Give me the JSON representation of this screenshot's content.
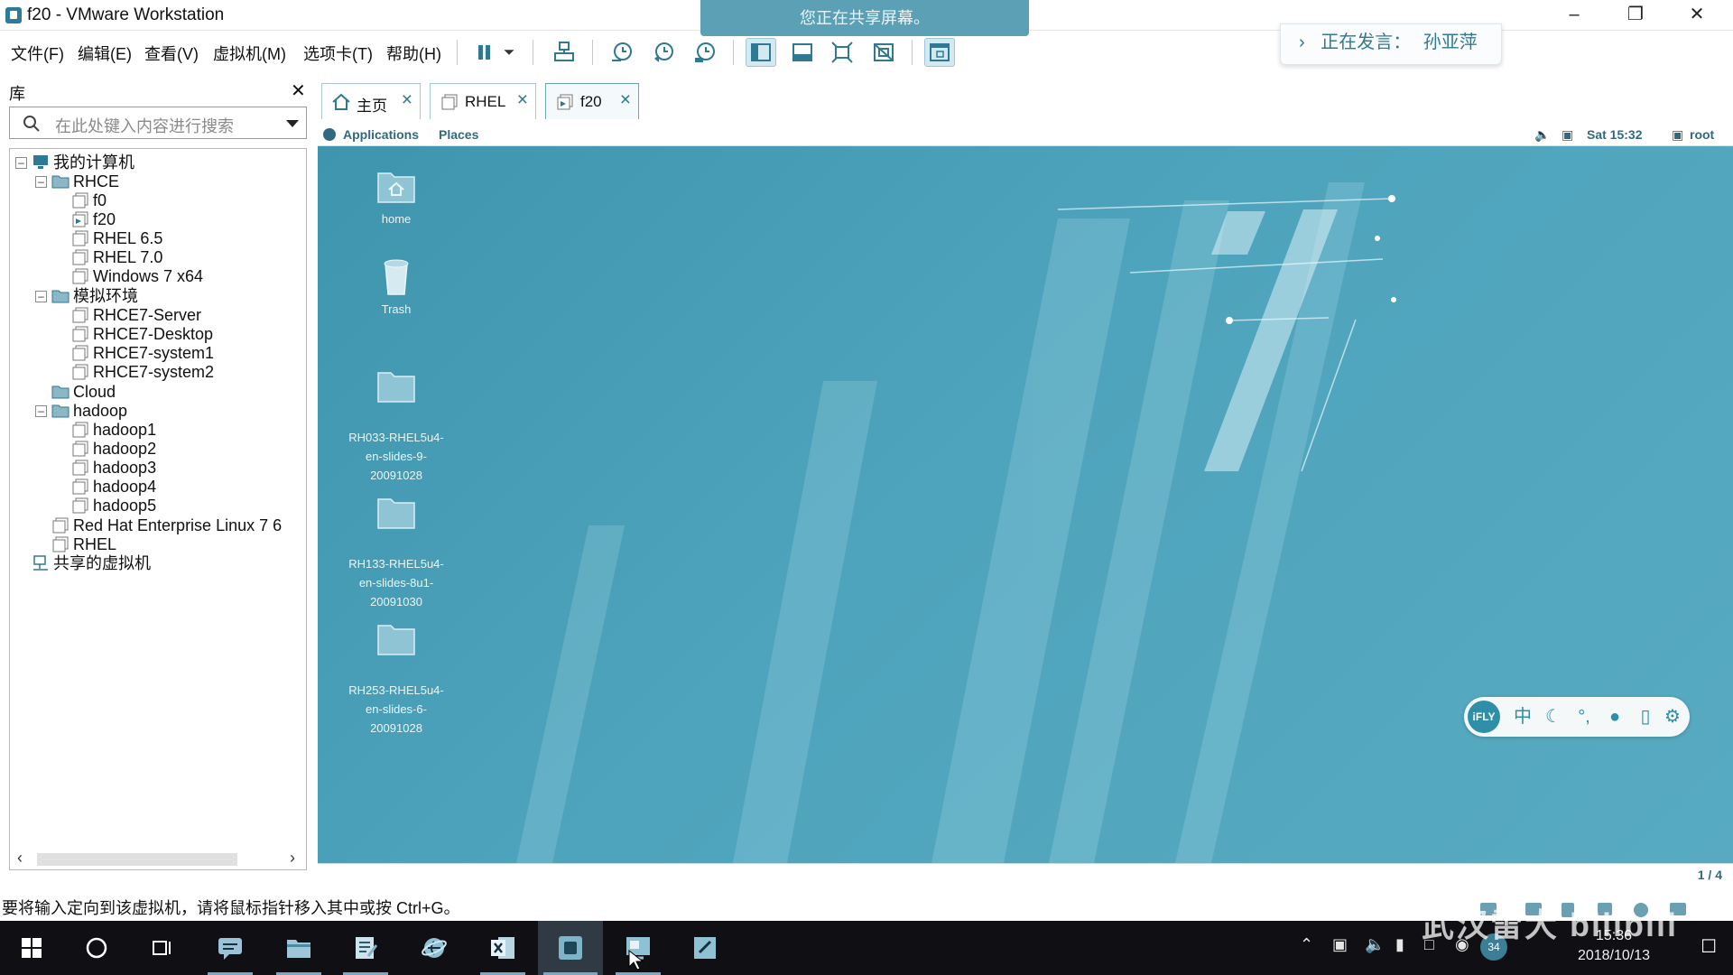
{
  "window": {
    "title": "f20 - VMware Workstation",
    "share_banner": "您正在共享屏幕。",
    "speaker_label": "正在发言：",
    "speaker_name": "孙亚萍",
    "speaker_chevron": "›"
  },
  "menu": {
    "file": "文件(F)",
    "edit": "编辑(E)",
    "view": "查看(V)",
    "vm": "虚拟机(M)",
    "tabs": "选项卡(T)",
    "help": "帮助(H)"
  },
  "library": {
    "title": "库",
    "search_placeholder": "在此处键入内容进行搜索",
    "tree": {
      "my_computer": "我的计算机",
      "rhce": "RHCE",
      "f0": "f0",
      "f20": "f20",
      "rhel65": "RHEL 6.5",
      "rhel70": "RHEL 7.0",
      "win7": "Windows 7 x64",
      "sim_env": "模拟环境",
      "rhce7_server": "RHCE7-Server",
      "rhce7_desktop": "RHCE7-Desktop",
      "rhce7_system1": "RHCE7-system1",
      "rhce7_system2": "RHCE7-system2",
      "cloud": "Cloud",
      "hadoop": "hadoop",
      "hadoop1": "hadoop1",
      "hadoop2": "hadoop2",
      "hadoop3": "hadoop3",
      "hadoop4": "hadoop4",
      "hadoop5": "hadoop5",
      "rhel7_6": "Red Hat Enterprise Linux 7 6",
      "rhel": "RHEL",
      "shared_vms": "共享的虚拟机"
    }
  },
  "tabs": [
    {
      "label": "主页"
    },
    {
      "label": "RHEL"
    },
    {
      "label": "f20"
    }
  ],
  "guest": {
    "applications": "Applications",
    "places": "Places",
    "clock": "Sat 15:32",
    "user": "root",
    "desktop_icons": [
      {
        "label": "home"
      },
      {
        "label": "Trash"
      },
      {
        "label": "RH033-RHEL5u4-\nen-slides-9-\n20091028"
      },
      {
        "label": "RH133-RHEL5u4-\nen-slides-8u1-\n20091030"
      },
      {
        "label": "RH253-RHEL5u4-\nen-slides-6-\n20091028"
      }
    ],
    "ime": {
      "logo": "iFLY",
      "lang": "中"
    },
    "pager": "1 / 4"
  },
  "statusbar": {
    "hint": "要将输入定向到该虚拟机，请将鼠标指针移入其中或按 Ctrl+G。"
  },
  "taskbar": {
    "date": "2018/10/13",
    "time": "15:36",
    "badge": "34",
    "watermark": "武汉雷大 bilibili"
  },
  "colors": {
    "accent": "#2f7a92",
    "desktop": "#4ea4bc",
    "taskbar": "#101014"
  }
}
